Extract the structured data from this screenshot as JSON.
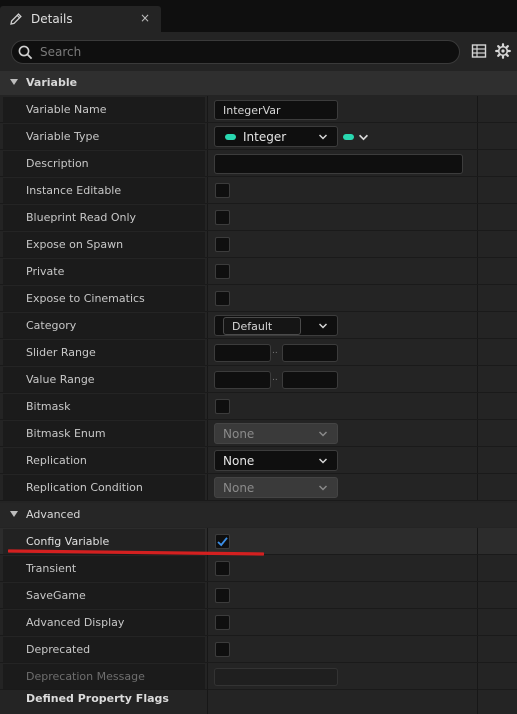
{
  "tab": {
    "title": "Details",
    "close": "×"
  },
  "search": {
    "placeholder": "Search"
  },
  "sections": {
    "variable": "Variable",
    "advanced": "Advanced"
  },
  "rows": {
    "variable_name": {
      "label": "Variable Name",
      "value": "IntegerVar"
    },
    "variable_type": {
      "label": "Variable Type",
      "value": "Integer"
    },
    "description": {
      "label": "Description",
      "value": ""
    },
    "instance_editable": {
      "label": "Instance Editable",
      "checked": false
    },
    "blueprint_read_only": {
      "label": "Blueprint Read Only",
      "checked": false
    },
    "expose_on_spawn": {
      "label": "Expose on Spawn",
      "checked": false
    },
    "private": {
      "label": "Private",
      "checked": false
    },
    "expose_to_cinematics": {
      "label": "Expose to Cinematics",
      "checked": false
    },
    "category": {
      "label": "Category",
      "value": "Default"
    },
    "slider_range": {
      "label": "Slider Range",
      "sep": ".."
    },
    "value_range": {
      "label": "Value Range",
      "sep": ".."
    },
    "bitmask": {
      "label": "Bitmask",
      "checked": false
    },
    "bitmask_enum": {
      "label": "Bitmask Enum",
      "value": "None"
    },
    "replication": {
      "label": "Replication",
      "value": "None"
    },
    "replication_condition": {
      "label": "Replication Condition",
      "value": "None"
    },
    "config_variable": {
      "label": "Config Variable",
      "checked": true
    },
    "transient": {
      "label": "Transient",
      "checked": false
    },
    "savegame": {
      "label": "SaveGame",
      "checked": false
    },
    "advanced_display": {
      "label": "Advanced Display",
      "checked": false
    },
    "deprecated": {
      "label": "Deprecated",
      "checked": false
    },
    "deprecation_message": {
      "label": "Deprecation Message",
      "value": ""
    },
    "defined_property_flags": {
      "label": "Defined Property Flags"
    }
  },
  "colors": {
    "type_pin": "#29d8b0",
    "checkmark": "#3b8fe8",
    "annotation": "#d42020"
  },
  "icons": {
    "tab": "pencil-icon",
    "search": "search-icon",
    "toolbar": [
      "table-view-icon",
      "settings-gear-icon"
    ]
  }
}
